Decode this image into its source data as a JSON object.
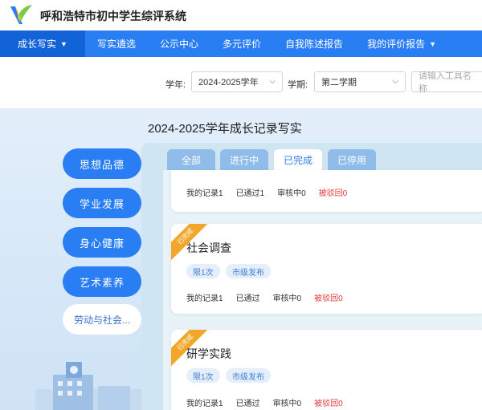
{
  "header": {
    "title": "呼和浩特市初中学生综评系统"
  },
  "nav": {
    "items": [
      {
        "label": "成长写实",
        "caret": "⌄"
      },
      {
        "label": "写实遴选"
      },
      {
        "label": "公示中心"
      },
      {
        "label": "多元评价"
      },
      {
        "label": "自我陈述报告"
      },
      {
        "label": "我的评价报告",
        "caret": "⌄"
      }
    ]
  },
  "filters": {
    "year_label": "学年:",
    "year_value": "2024-2025学年",
    "term_label": "学期:",
    "term_value": "第二学期",
    "search_placeholder": "请输入工具名称"
  },
  "main": {
    "title": "2024-2025学年成长记录写实",
    "categories": [
      "思想品德",
      "学业发展",
      "身心健康",
      "艺术素养",
      "劳动与社会..."
    ],
    "tabs": [
      "全部",
      "进行中",
      "已完成",
      "已停用"
    ]
  },
  "cards": [
    {
      "stats": [
        "我的记录1",
        "已通过1",
        "审核中0",
        "被驳回0"
      ]
    },
    {
      "ribbon": "已完成",
      "title": "社会调查",
      "tags": [
        "限1次",
        "市级发布"
      ],
      "stats": [
        "我的记录1",
        "已通过",
        "审核中0",
        "被驳回0"
      ]
    },
    {
      "ribbon": "已完成",
      "title": "研学实践",
      "tags": [
        "限1次",
        "市级发布"
      ],
      "stats": [
        "我的记录1",
        "已通过",
        "审核中0",
        "被驳回0"
      ]
    }
  ],
  "colors": {
    "primary": "#2a7ef3",
    "primary_dark": "#1262d8",
    "ribbon": "#f2a72b",
    "rejected": "#e23b3b"
  }
}
